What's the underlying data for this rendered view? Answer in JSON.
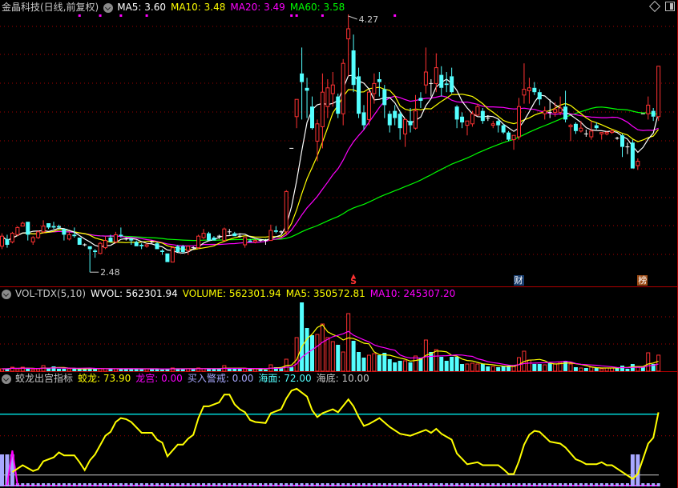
{
  "header": {
    "title": "金晶科技(日线,前复权)",
    "ma5": "MA5: 3.60",
    "ma10": "MA10: 3.48",
    "ma20": "MA20: 3.49",
    "ma60": "MA60: 3.58",
    "icons": [
      "dropdown-icon",
      "diamond-icon",
      "panel-toggle-icon"
    ]
  },
  "volume_header": {
    "name": "VOL-TDX(5,10)",
    "wvol": "WVOL: 562301.94",
    "volume": "VOLUME: 562301.94",
    "ma5": "MA5: 350572.81",
    "ma10": "MA10: 245307.20"
  },
  "indicator_header": {
    "name": "蛟龙出宫指标",
    "jiaolong": "蛟龙: 73.90",
    "longgong": "龙宫: 0.00",
    "buy_alert": "买入警戒: 0.00",
    "sea_surface": "海面: 72.00",
    "sea_floor": "海底: 10.00"
  },
  "markers": {
    "s_label": "S",
    "cai_label": "财",
    "bang_label": "榜"
  },
  "colors": {
    "up": "#ff3232",
    "down": "#54ffff",
    "flat": "#ffffff",
    "ma5": "#ffffff",
    "ma10": "#ffff00",
    "ma20": "#ff00ff",
    "ma60": "#00ff00",
    "grid": "#a00000",
    "separator": "#b00000",
    "jiaolong": "#ffff00",
    "longgong": "#ff00ff",
    "buy_alert": "#a8a8ff",
    "sea_surface": "#00ffff",
    "sea_floor": "#c8c8c8"
  },
  "chart_data": [
    {
      "type": "candlestick",
      "title": "金晶科技(日线,前复权)",
      "high_label": "4.27",
      "low_label": "2.48",
      "ylim": [
        2.48,
        4.27
      ],
      "grid": true,
      "moving_averages": [
        5,
        10,
        20,
        60
      ],
      "marker_bars": {
        "s": 68,
        "cai": 100,
        "bang": 124
      },
      "info_marker_bars": [
        15,
        19,
        23,
        28,
        56,
        57,
        62,
        76
      ],
      "ohlc": [
        [
          2.66,
          2.75,
          2.64,
          2.73
        ],
        [
          2.71,
          2.74,
          2.65,
          2.67
        ],
        [
          2.69,
          2.76,
          2.68,
          2.75
        ],
        [
          2.74,
          2.8,
          2.73,
          2.79
        ],
        [
          2.8,
          2.83,
          2.8,
          2.82
        ],
        [
          2.83,
          2.83,
          2.7,
          2.74
        ],
        [
          2.69,
          2.73,
          2.67,
          2.72
        ],
        [
          2.72,
          2.77,
          2.71,
          2.76
        ],
        [
          2.76,
          2.84,
          2.75,
          2.8
        ],
        [
          2.82,
          2.82,
          2.78,
          2.79
        ],
        [
          2.8,
          2.83,
          2.78,
          2.79
        ],
        [
          2.8,
          2.81,
          2.78,
          2.79
        ],
        [
          2.78,
          2.78,
          2.7,
          2.74
        ],
        [
          2.71,
          2.76,
          2.7,
          2.74
        ],
        [
          2.74,
          2.79,
          2.72,
          2.73
        ],
        [
          2.72,
          2.72,
          2.67,
          2.67
        ],
        [
          2.67,
          2.68,
          2.66,
          2.67
        ],
        [
          2.66,
          2.66,
          2.48,
          2.64
        ],
        [
          2.63,
          2.64,
          2.58,
          2.62
        ],
        [
          2.61,
          2.69,
          2.61,
          2.68
        ],
        [
          2.65,
          2.73,
          2.64,
          2.7
        ],
        [
          2.72,
          2.74,
          2.69,
          2.69
        ],
        [
          2.69,
          2.76,
          2.68,
          2.74
        ],
        [
          2.74,
          2.79,
          2.72,
          2.73
        ],
        [
          2.71,
          2.72,
          2.7,
          2.71
        ],
        [
          2.71,
          2.72,
          2.67,
          2.7
        ],
        [
          2.69,
          2.7,
          2.66,
          2.66
        ],
        [
          2.67,
          2.68,
          2.64,
          2.66
        ],
        [
          2.66,
          2.68,
          2.65,
          2.67
        ],
        [
          2.69,
          2.7,
          2.68,
          2.69
        ],
        [
          2.68,
          2.69,
          2.64,
          2.64
        ],
        [
          2.63,
          2.64,
          2.6,
          2.62
        ],
        [
          2.61,
          2.61,
          2.55,
          2.55
        ],
        [
          2.55,
          2.66,
          2.55,
          2.65
        ],
        [
          2.66,
          2.67,
          2.62,
          2.62
        ],
        [
          2.66,
          2.67,
          2.61,
          2.62
        ],
        [
          2.63,
          2.66,
          2.6,
          2.66
        ],
        [
          2.65,
          2.66,
          2.64,
          2.65
        ],
        [
          2.65,
          2.74,
          2.64,
          2.73
        ],
        [
          2.72,
          2.78,
          2.71,
          2.75
        ],
        [
          2.75,
          2.76,
          2.7,
          2.7
        ],
        [
          2.72,
          2.73,
          2.7,
          2.7
        ],
        [
          2.73,
          2.74,
          2.71,
          2.73
        ],
        [
          2.7,
          2.79,
          2.7,
          2.78
        ],
        [
          2.76,
          2.78,
          2.74,
          2.76
        ],
        [
          2.75,
          2.76,
          2.73,
          2.73
        ],
        [
          2.73,
          2.75,
          2.72,
          2.73
        ],
        [
          2.67,
          2.72,
          2.65,
          2.72
        ],
        [
          2.7,
          2.71,
          2.69,
          2.69
        ],
        [
          2.69,
          2.71,
          2.68,
          2.7
        ],
        [
          2.7,
          2.71,
          2.69,
          2.7
        ],
        [
          2.7,
          2.71,
          2.67,
          2.7
        ],
        [
          2.7,
          2.81,
          2.7,
          2.77
        ],
        [
          2.77,
          2.8,
          2.75,
          2.76
        ],
        [
          2.76,
          2.77,
          2.75,
          2.76
        ],
        [
          2.76,
          3.05,
          2.74,
          3.04
        ],
        [
          3.34,
          3.34,
          3.34,
          3.34
        ],
        [
          3.56,
          3.68,
          3.48,
          3.68
        ],
        [
          3.86,
          4.04,
          3.54,
          3.8
        ],
        [
          3.76,
          3.83,
          3.55,
          3.74
        ],
        [
          3.63,
          3.7,
          3.47,
          3.48
        ],
        [
          3.39,
          3.54,
          3.25,
          3.51
        ],
        [
          3.49,
          3.86,
          3.34,
          3.73
        ],
        [
          3.63,
          3.82,
          3.55,
          3.76
        ],
        [
          3.72,
          3.87,
          3.63,
          3.78
        ],
        [
          3.7,
          3.72,
          3.55,
          3.58
        ],
        [
          3.58,
          3.96,
          3.5,
          3.93
        ],
        [
          4.1,
          4.27,
          3.84,
          4.17
        ],
        [
          4.02,
          4.13,
          3.73,
          3.78
        ],
        [
          3.84,
          3.9,
          3.55,
          3.58
        ],
        [
          3.59,
          3.64,
          3.47,
          3.5
        ],
        [
          3.54,
          3.74,
          3.5,
          3.73
        ],
        [
          3.72,
          3.86,
          3.65,
          3.79
        ],
        [
          3.82,
          3.87,
          3.7,
          3.8
        ],
        [
          3.75,
          3.78,
          3.55,
          3.64
        ],
        [
          3.58,
          3.6,
          3.45,
          3.5
        ],
        [
          3.6,
          3.64,
          3.5,
          3.55
        ],
        [
          3.58,
          3.6,
          3.4,
          3.48
        ],
        [
          3.44,
          3.55,
          3.35,
          3.54
        ],
        [
          3.53,
          3.62,
          3.45,
          3.5
        ],
        [
          3.48,
          3.71,
          3.47,
          3.6
        ],
        [
          3.69,
          3.73,
          3.62,
          3.67
        ],
        [
          3.78,
          4.04,
          3.72,
          3.87
        ],
        [
          3.79,
          3.82,
          3.7,
          3.79
        ],
        [
          3.79,
          4.0,
          3.73,
          3.9
        ],
        [
          3.85,
          3.91,
          3.7,
          3.76
        ],
        [
          3.79,
          3.87,
          3.73,
          3.78
        ],
        [
          3.84,
          3.9,
          3.72,
          3.73
        ],
        [
          3.63,
          3.64,
          3.48,
          3.54
        ],
        [
          3.56,
          3.59,
          3.48,
          3.52
        ],
        [
          3.5,
          3.53,
          3.43,
          3.53
        ],
        [
          3.51,
          3.6,
          3.49,
          3.58
        ],
        [
          3.57,
          3.65,
          3.57,
          3.63
        ],
        [
          3.6,
          3.62,
          3.51,
          3.53
        ],
        [
          3.55,
          3.57,
          3.53,
          3.55
        ],
        [
          3.5,
          3.53,
          3.48,
          3.51
        ],
        [
          3.53,
          3.54,
          3.45,
          3.5
        ],
        [
          3.5,
          3.51,
          3.44,
          3.45
        ],
        [
          3.45,
          3.46,
          3.39,
          3.4
        ],
        [
          3.4,
          3.43,
          3.33,
          3.43
        ],
        [
          3.42,
          3.69,
          3.4,
          3.63
        ],
        [
          3.71,
          3.93,
          3.65,
          3.75
        ],
        [
          3.74,
          3.83,
          3.65,
          3.76
        ],
        [
          3.76,
          3.8,
          3.71,
          3.73
        ],
        [
          3.73,
          3.75,
          3.64,
          3.68
        ],
        [
          3.58,
          3.63,
          3.54,
          3.6
        ],
        [
          3.59,
          3.68,
          3.55,
          3.59
        ],
        [
          3.59,
          3.66,
          3.56,
          3.61
        ],
        [
          3.59,
          3.7,
          3.57,
          3.62
        ],
        [
          3.63,
          3.74,
          3.52,
          3.54
        ],
        [
          3.49,
          3.51,
          3.39,
          3.5
        ],
        [
          3.51,
          3.52,
          3.44,
          3.46
        ],
        [
          3.46,
          3.53,
          3.45,
          3.48
        ],
        [
          3.44,
          3.47,
          3.42,
          3.44
        ],
        [
          3.42,
          3.53,
          3.4,
          3.46
        ],
        [
          3.5,
          3.52,
          3.47,
          3.48
        ],
        [
          3.44,
          3.45,
          3.4,
          3.45
        ],
        [
          3.44,
          3.46,
          3.43,
          3.45
        ],
        [
          3.45,
          3.47,
          3.44,
          3.46
        ],
        [
          3.41,
          3.42,
          3.4,
          3.41
        ],
        [
          3.43,
          3.44,
          3.28,
          3.35
        ],
        [
          3.35,
          3.38,
          3.3,
          3.35
        ],
        [
          3.38,
          3.4,
          3.2,
          3.2
        ],
        [
          3.22,
          3.27,
          3.19,
          3.25
        ],
        [
          3.58,
          3.58,
          3.58,
          3.58
        ],
        [
          3.58,
          3.7,
          3.54,
          3.64
        ],
        [
          3.6,
          3.62,
          3.53,
          3.56
        ],
        [
          3.56,
          3.91,
          3.53,
          3.91
        ]
      ]
    },
    {
      "type": "bar",
      "title": "VOL-TDX(5,10)",
      "moving_averages": [
        5,
        10
      ],
      "grid": true,
      "volume": [
        84000,
        84000,
        140000,
        84000,
        140000,
        84000,
        56000,
        84000,
        196000,
        112000,
        168000,
        84000,
        84000,
        84000,
        84000,
        84000,
        84000,
        112000,
        84000,
        84000,
        84000,
        84000,
        84000,
        84000,
        84000,
        84000,
        84000,
        84000,
        84000,
        84000,
        84000,
        56000,
        84000,
        112000,
        84000,
        84000,
        84000,
        84000,
        112000,
        84000,
        84000,
        84000,
        84000,
        196000,
        84000,
        84000,
        84000,
        84000,
        84000,
        84000,
        84000,
        56000,
        224000,
        140000,
        140000,
        420000,
        140000,
        1176000,
        2408000,
        1512000,
        1260000,
        1288000,
        1652000,
        1176000,
        1036000,
        924000,
        672000,
        2016000,
        1064000,
        672000,
        476000,
        560000,
        616000,
        560000,
        644000,
        420000,
        308000,
        364000,
        364000,
        308000,
        532000,
        476000,
        1092000,
        672000,
        756000,
        504000,
        364000,
        504000,
        504000,
        252000,
        252000,
        280000,
        252000,
        252000,
        168000,
        168000,
        140000,
        168000,
        196000,
        168000,
        476000,
        700000,
        392000,
        252000,
        252000,
        224000,
        280000,
        252000,
        308000,
        364000,
        252000,
        140000,
        112000,
        112000,
        140000,
        112000,
        84000,
        112000,
        112000,
        140000,
        196000,
        84000,
        252000,
        140000,
        140000,
        644000,
        252000,
        562301.94
      ]
    },
    {
      "type": "line",
      "title": "蛟龙出宫指标",
      "ylim": [
        0,
        100
      ],
      "reference_lines": {
        "sea_surface": 72,
        "sea_floor": 10,
        "grid": 50
      },
      "jiaolong_keypoints": [
        [
          2,
          13
        ],
        [
          4,
          20
        ],
        [
          6,
          14
        ],
        [
          7,
          16
        ],
        [
          8,
          24
        ],
        [
          10,
          28
        ],
        [
          11,
          33
        ],
        [
          12,
          30
        ],
        [
          14,
          30
        ],
        [
          15,
          23
        ],
        [
          16,
          15
        ],
        [
          17,
          25
        ],
        [
          18,
          31
        ],
        [
          20,
          50
        ],
        [
          21,
          54
        ],
        [
          22,
          64
        ],
        [
          23,
          68
        ],
        [
          24,
          67
        ],
        [
          25,
          64
        ],
        [
          27,
          53
        ],
        [
          29,
          53
        ],
        [
          30,
          46
        ],
        [
          31,
          43
        ],
        [
          32,
          29
        ],
        [
          34,
          41
        ],
        [
          35,
          41
        ],
        [
          36,
          47
        ],
        [
          37,
          51
        ],
        [
          38,
          68
        ],
        [
          39,
          80
        ],
        [
          40,
          80
        ],
        [
          42,
          84
        ],
        [
          43,
          92
        ],
        [
          44,
          92
        ],
        [
          45,
          82
        ],
        [
          46,
          77
        ],
        [
          47,
          74
        ],
        [
          48,
          66
        ],
        [
          49,
          64
        ],
        [
          51,
          63
        ],
        [
          52,
          73
        ],
        [
          54,
          77
        ],
        [
          55,
          88
        ],
        [
          56,
          96
        ],
        [
          57,
          98
        ],
        [
          59,
          90
        ],
        [
          60,
          76
        ],
        [
          61,
          69
        ],
        [
          62,
          73
        ],
        [
          64,
          77
        ],
        [
          65,
          74
        ],
        [
          67,
          87
        ],
        [
          68,
          80
        ],
        [
          69,
          69
        ],
        [
          70,
          60
        ],
        [
          71,
          62
        ],
        [
          73,
          68
        ],
        [
          75,
          59
        ],
        [
          77,
          52
        ],
        [
          79,
          50
        ],
        [
          80,
          52
        ],
        [
          82,
          56
        ],
        [
          83,
          53
        ],
        [
          84,
          57
        ],
        [
          85,
          52
        ],
        [
          87,
          46
        ],
        [
          88,
          32
        ],
        [
          90,
          21
        ],
        [
          92,
          23
        ],
        [
          93,
          20
        ],
        [
          96,
          20
        ],
        [
          97,
          16
        ],
        [
          98,
          11
        ],
        [
          99,
          11
        ],
        [
          100,
          24
        ],
        [
          101,
          41
        ],
        [
          102,
          51
        ],
        [
          103,
          55
        ],
        [
          104,
          54
        ],
        [
          106,
          44
        ],
        [
          108,
          42
        ],
        [
          109,
          38
        ],
        [
          111,
          26
        ],
        [
          112,
          24
        ],
        [
          113,
          21
        ],
        [
          115,
          21
        ],
        [
          116,
          23
        ],
        [
          117,
          20
        ],
        [
          118,
          20
        ],
        [
          120,
          13
        ],
        [
          122,
          6
        ],
        [
          123,
          11
        ],
        [
          125,
          42
        ],
        [
          126,
          48
        ],
        [
          127,
          73.9
        ]
      ],
      "longgong_points": [
        [
          1,
          0
        ],
        [
          2,
          35
        ],
        [
          3,
          0
        ]
      ],
      "buy_alert_bars": [
        [
          0,
          31
        ],
        [
          1,
          31
        ],
        [
          2,
          31
        ],
        [
          122,
          31
        ],
        [
          123,
          31
        ]
      ]
    }
  ]
}
